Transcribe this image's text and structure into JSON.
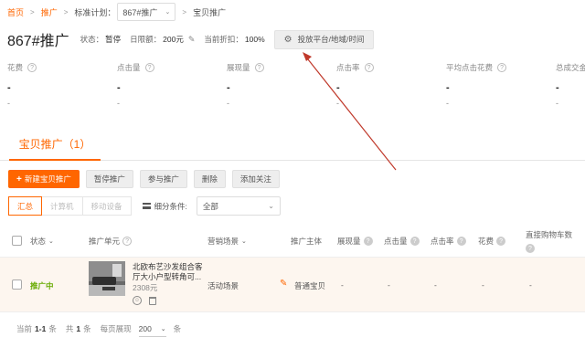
{
  "breadcrumb": {
    "home": "首页",
    "promotion": "推广",
    "plan_label": "标准计划：",
    "plan_value": "867#推广",
    "current": "宝贝推广"
  },
  "header": {
    "plan_name": "867#推广",
    "status_label": "状态：",
    "status_value": "暂停",
    "budget_label": "日限额：",
    "budget_value": "200元",
    "discount_label": "当前折扣：",
    "discount_value": "100%",
    "settings_button": "投放平台/地域/时间"
  },
  "metrics": [
    {
      "label": "花费",
      "value": "-",
      "sub": "-"
    },
    {
      "label": "点击量",
      "value": "-",
      "sub": "-"
    },
    {
      "label": "展现量",
      "value": "-",
      "sub": "-"
    },
    {
      "label": "点击率",
      "value": "-",
      "sub": "-"
    },
    {
      "label": "平均点击花费",
      "value": "-",
      "sub": "-"
    },
    {
      "label": "总成交金",
      "value": "-",
      "sub": "-"
    }
  ],
  "section_tab": "宝贝推广（1）",
  "actions": {
    "new": "新建宝贝推广",
    "pause": "暂停推广",
    "join": "参与推广",
    "delete": "删除",
    "follow": "添加关注"
  },
  "view_tabs": [
    "汇总",
    "计算机",
    "移动设备"
  ],
  "filter": {
    "label": "细分条件:",
    "value": "全部"
  },
  "table": {
    "headers": {
      "status": "状态",
      "unit": "推广单元",
      "scene": "营销场景",
      "subject": "推广主体",
      "impressions": "展现量",
      "clicks": "点击量",
      "ctr": "点击率",
      "cost": "花费",
      "cart": "直接购物车数"
    },
    "row": {
      "status": "推广中",
      "title_line1": "北欧布艺沙发组合客",
      "title_line2": "厅大小户型转角可...",
      "price": "2308元",
      "scene": "活动场景",
      "subject": "普通宝贝",
      "impressions": "-",
      "clicks": "-",
      "ctr": "-",
      "cost": "-",
      "cart": "-"
    }
  },
  "pager": {
    "current_prefix": "当前",
    "current_range": "1-1",
    "current_suffix": "条",
    "total_prefix": "共",
    "total": "1",
    "total_suffix": "条",
    "per_page_label": "每页展现",
    "per_page": "200",
    "per_page_suffix": "条"
  },
  "colors": {
    "accent": "#ff6600",
    "status_active": "#66aa00",
    "annotation_arrow": "#c0392b"
  }
}
